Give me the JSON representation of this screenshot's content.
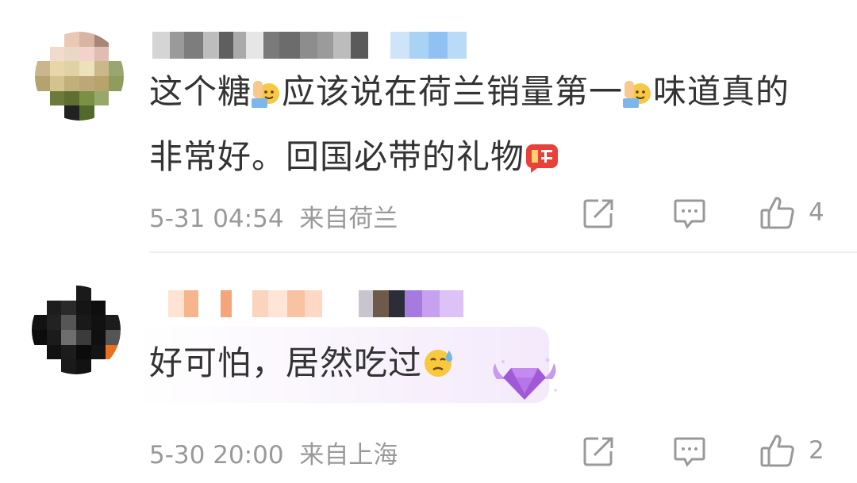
{
  "comments": [
    {
      "text_line1_a": "这个糖",
      "text_line1_b": "应该说在荷兰销量第一",
      "text_line1_c": "味道真的",
      "text_line2": "非常好。回国必带的礼物",
      "inline_emojis": [
        "waving-hand-emoji",
        "waving-hand-emoji",
        "gift-red-packet-emoji"
      ],
      "time": "5-31 04:54",
      "location": "来自荷兰",
      "like_count": "4"
    },
    {
      "text": "好可怕，居然吃过",
      "inline_emojis": [
        "sweat-face-emoji"
      ],
      "time": "5-30 20:00",
      "location": "来自上海",
      "like_count": "2"
    }
  ],
  "colors": {
    "text": "#333333",
    "meta": "#999999",
    "divider": "#efefef",
    "badge_purple": "#a05ad8"
  },
  "icons": {
    "share": "share-icon",
    "reply": "comment-icon",
    "like": "thumbs-up-icon"
  }
}
